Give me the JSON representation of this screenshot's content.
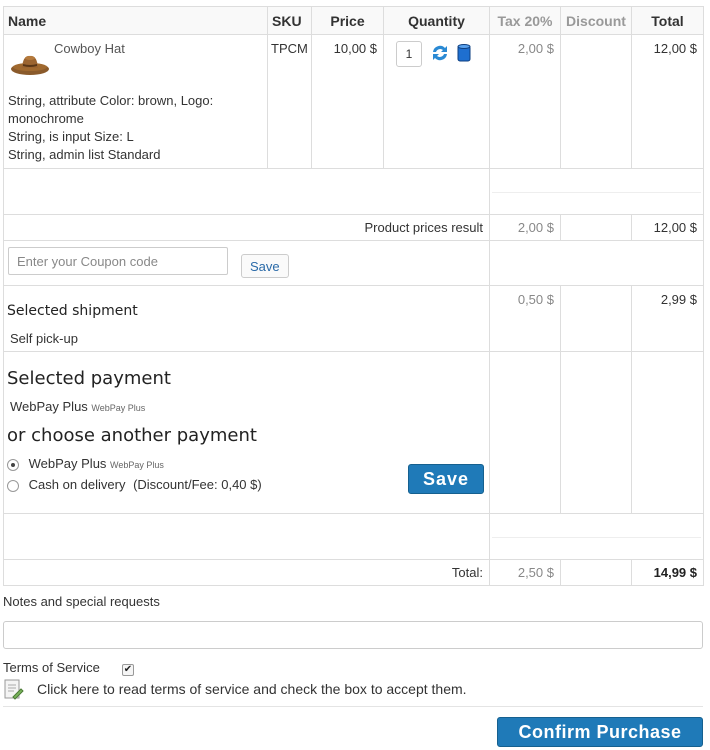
{
  "table": {
    "headers": {
      "name": "Name",
      "sku": "SKU",
      "price": "Price",
      "quantity": "Quantity",
      "tax": "Tax 20%",
      "discount": "Discount",
      "total": "Total"
    },
    "product": {
      "name": "Cowboy Hat",
      "attr_line1": "String, attribute Color: brown, Logo: monochrome",
      "attr_line2": "String, is input Size: L",
      "attr_line3": "String, admin list Standard",
      "sku": "TPCM",
      "price": "10,00 $",
      "quantity": "1",
      "tax": "2,00 $",
      "total": "12,00 $"
    },
    "product_result": {
      "label": "Product prices result",
      "tax": "2,00 $",
      "total": "12,00 $"
    },
    "coupon": {
      "placeholder": "Enter your Coupon code",
      "save_label": "Save"
    },
    "shipment": {
      "heading": "Selected shipment",
      "method": "Self pick-up",
      "tax": "0,50 $",
      "total": "2,99 $"
    },
    "payment": {
      "heading": "Selected payment",
      "selected_name": "WebPay Plus",
      "selected_desc": "WebPay Plus",
      "choose_heading": "or choose another payment",
      "options": [
        {
          "name": "WebPay Plus",
          "desc": "WebPay Plus",
          "checked": true
        },
        {
          "name": "Cash on delivery",
          "desc": "(Discount/Fee: 0,40 $)",
          "checked": false
        }
      ],
      "save_label": "Save"
    },
    "grand_total": {
      "label": "Total:",
      "tax": "2,50 $",
      "total": "14,99 $"
    }
  },
  "notes": {
    "label": "Notes and special requests",
    "value": ""
  },
  "terms": {
    "label": "Terms of Service",
    "checked": true,
    "description": "Click here to read terms of service and check the box to accept them."
  },
  "confirm": {
    "label": "Confirm Purchase"
  },
  "colors": {
    "accent": "#1f7ab8",
    "muted_text": "#888888",
    "border": "#dddddd"
  }
}
